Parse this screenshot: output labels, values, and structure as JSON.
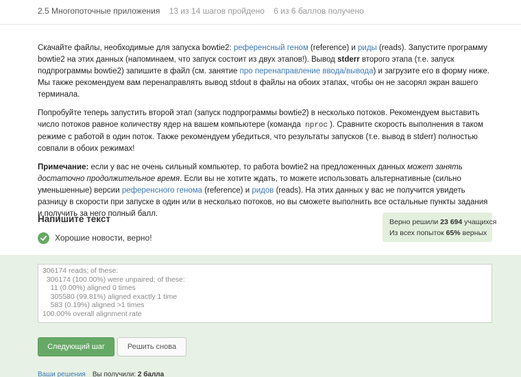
{
  "header": {
    "lesson": "2.5 Многопоточные приложения",
    "steps_progress": "13 из 14 шагов пройдено",
    "points_progress": "6 из 6 баллов  получено"
  },
  "step": {
    "p1": {
      "t1": "Скачайте файлы, необходимые для запуска bowtie2: ",
      "link_genome": "референсный геном",
      "t2": " (reference) и ",
      "link_reads": "риды",
      "t3": " (reads). Запустите программу bowtie2 на этих данных (напоминаем, что запуск состоит из двух этапов!). Вывод ",
      "stderr": "stderr",
      "t4": " второго этапа (т.е. запуск подпрограммы bowtie2) запишите в файл (см. занятие ",
      "link_redirect": "про перенаправление ввода/вывода",
      "t5": ") и загрузите его в форму ниже. Мы также рекомендуем вам перенаправлять вывод stdout в файлы на обоих этапах, чтобы он не засорял экран вашего терминала."
    },
    "p2": {
      "t1": "Попробуйте теперь запустить второй этап (запуск подпрограммы bowtie2) в несколько потоков. Рекомендуем выставить число потоков равное количеству ядер на вашем компьютере (команда ",
      "code": "nproc",
      "t2": "). Сравните скорость выполнения в таком режиме с работой в один поток. Также рекомендуем убедиться, что результаты запусков (т.е. вывод в stderr) полностью совпали в обоих режимах!"
    },
    "p3": {
      "label": "Примечание:",
      "t1": " если у вас не очень сильный компьютер, то работа bowtie2 на предложенных данных ",
      "em": "может занять достаточно продолжительное время",
      "t2": ". Если вы не хотите ждать, то можете использовать альтернативные (сильно уменьшенные) версии ",
      "link_genome": "референсного генома",
      "t3": " (reference) и ",
      "link_reads": "ридов",
      "t4": " (reads). На этих данных у вас не получится увидеть разницу в скорости при запуске в один или в несколько потоков, но вы сможете выполнить все остальные пункты задания и получить за него полный балл."
    }
  },
  "task": {
    "title": "Напишите текст",
    "feedback": "Хорошие новости, верно!"
  },
  "stats": {
    "solved_prefix": "Верно решили ",
    "solved_count": "23 694",
    "solved_suffix": " учащихся",
    "attempts_prefix": "Из всех попыток ",
    "attempts_pct": "65%",
    "attempts_suffix": " верных"
  },
  "answer": {
    "value": "306174 reads; of these:\n  306174 (100.00%) were unpaired; of these:\n    11 (0.00%) aligned 0 times\n    305580 (99.81%) aligned exactly 1 time\n    583 (0.19%) aligned >1 times\n100.00% overall alignment rate"
  },
  "buttons": {
    "next": "Следующий шаг",
    "retry": "Решить снова"
  },
  "footer": {
    "your_solutions": "Ваши решения",
    "received_label": "Вы получили: ",
    "received_value": "2 балла"
  },
  "colors": {
    "accent_green": "#66a966",
    "link_blue": "#3c78b5",
    "zone_green": "#e8f1e5"
  },
  "icons": {
    "feedback": "check-circle-icon"
  }
}
